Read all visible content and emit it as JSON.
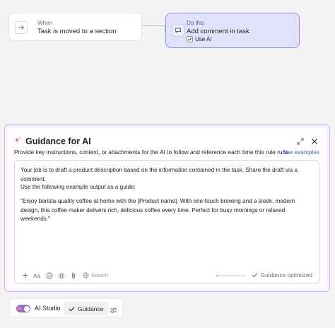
{
  "trigger": {
    "small_label": "When",
    "main_label": "Task is moved to a section",
    "icon": "arrow-right-icon"
  },
  "action": {
    "small_label": "Do this",
    "main_label": "Add comment in task",
    "use_ai_label": "Use AI",
    "use_ai_checked": true,
    "icon": "comment-icon"
  },
  "guidance": {
    "title": "Guidance for AI",
    "subtitle": "Provide key instructions, context, or attachments for the AI to follow and reference each time this rule runs.",
    "see_examples": "See examples",
    "editor": {
      "paragraph1": "Your job is to draft a product description based on the information contained in the task. Share the draft via a comment.",
      "paragraph2": "Use the following example output as a guide:",
      "paragraph3": "\"Enjoy barista-quality coffee at home with the [Product name]. With one-touch brewing and a sleek, modern design, this coffee maker delivers rich, delicious coffee every time. Perfect for busy mornings or relaxed weekends.\""
    },
    "toolbar": {
      "search_label": "Search",
      "icons": [
        "plus-icon",
        "text-format-icon",
        "emoji-icon",
        "mention-icon",
        "attach-icon",
        "globe-icon"
      ]
    },
    "progress_fraction": 0.05,
    "status": "Guidance optimized"
  },
  "bottom_bar": {
    "ai_studio_label": "AI Studio",
    "ai_studio_enabled": true,
    "guidance_label": "Guidance"
  },
  "colors": {
    "accent_purple": "#8b6de3",
    "action_card_bg": "#dfe2fa",
    "link_blue": "#3a6ad6"
  }
}
